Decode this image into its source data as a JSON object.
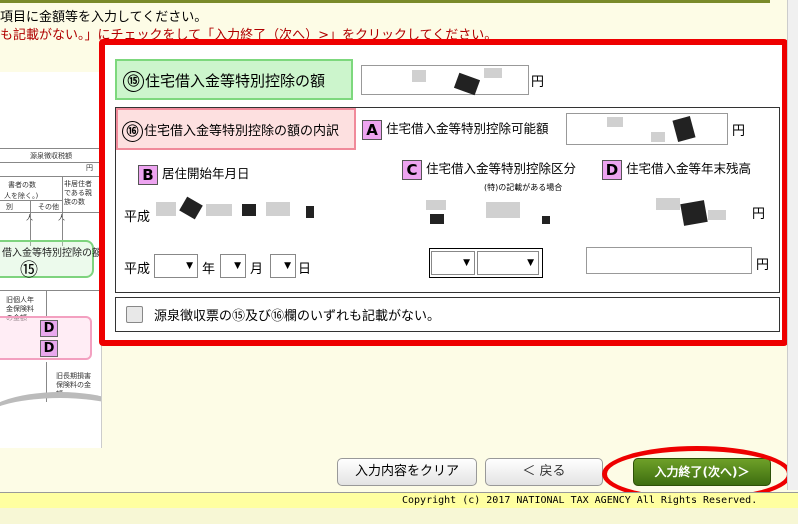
{
  "instructions": {
    "line1": "項目に金額等を入力してください。",
    "line2": "も記載がない。」にチェックをして「入力終了（次へ）>」をクリックしてください。"
  },
  "form_image": {
    "header": "源泉徴収税額",
    "yen_mark": "円",
    "dependents": "書者の数",
    "dependents_sub": "人を除く。)",
    "other": "その他",
    "nonresident": "非居住者である親族の数",
    "betsu": "別",
    "person": "人",
    "box15_label": "借入金等特別控除の額",
    "box15_number": "⑮",
    "old_pension": "旧個人年金保険料の金額",
    "d1": "D",
    "d2": "D",
    "old_longterm": "旧長期損害保険料の金額"
  },
  "section15": {
    "number": "⑮",
    "label": "住宅借入金等特別控除の額",
    "unit": "円"
  },
  "section16": {
    "number": "⑯",
    "label": "住宅借入金等特別控除の額の内訳",
    "field_a": {
      "tag": "A",
      "label": "住宅借入金等特別控除可能額",
      "unit": "円"
    },
    "field_b": {
      "tag": "B",
      "label": "居住開始年月日",
      "era": "平成",
      "year_unit": "年",
      "month_unit": "月",
      "day_unit": "日"
    },
    "field_c": {
      "tag": "C",
      "label": "住宅借入金等特別控除区分",
      "note": "(特)の記載がある場合"
    },
    "field_d": {
      "tag": "D",
      "label": "住宅借入金等年末残高",
      "unit": "円"
    }
  },
  "checkbox": {
    "label": "源泉徴収票の⑮及び⑯欄のいずれも記載がない。"
  },
  "buttons": {
    "clear": "入力内容をクリア",
    "back": "＜ 戻る",
    "next": "入力終了(次へ)＞"
  },
  "copyright": "Copyright (c) 2017 NATIONAL TAX AGENCY All Rights Reserved.",
  "colors": {
    "frame_red": "#ee0000",
    "green_label_bg": "#ccf5cc",
    "pink_label_bg": "#fde0e0",
    "tag_magenta": "#eda4f0",
    "next_button": "#4f8220"
  }
}
